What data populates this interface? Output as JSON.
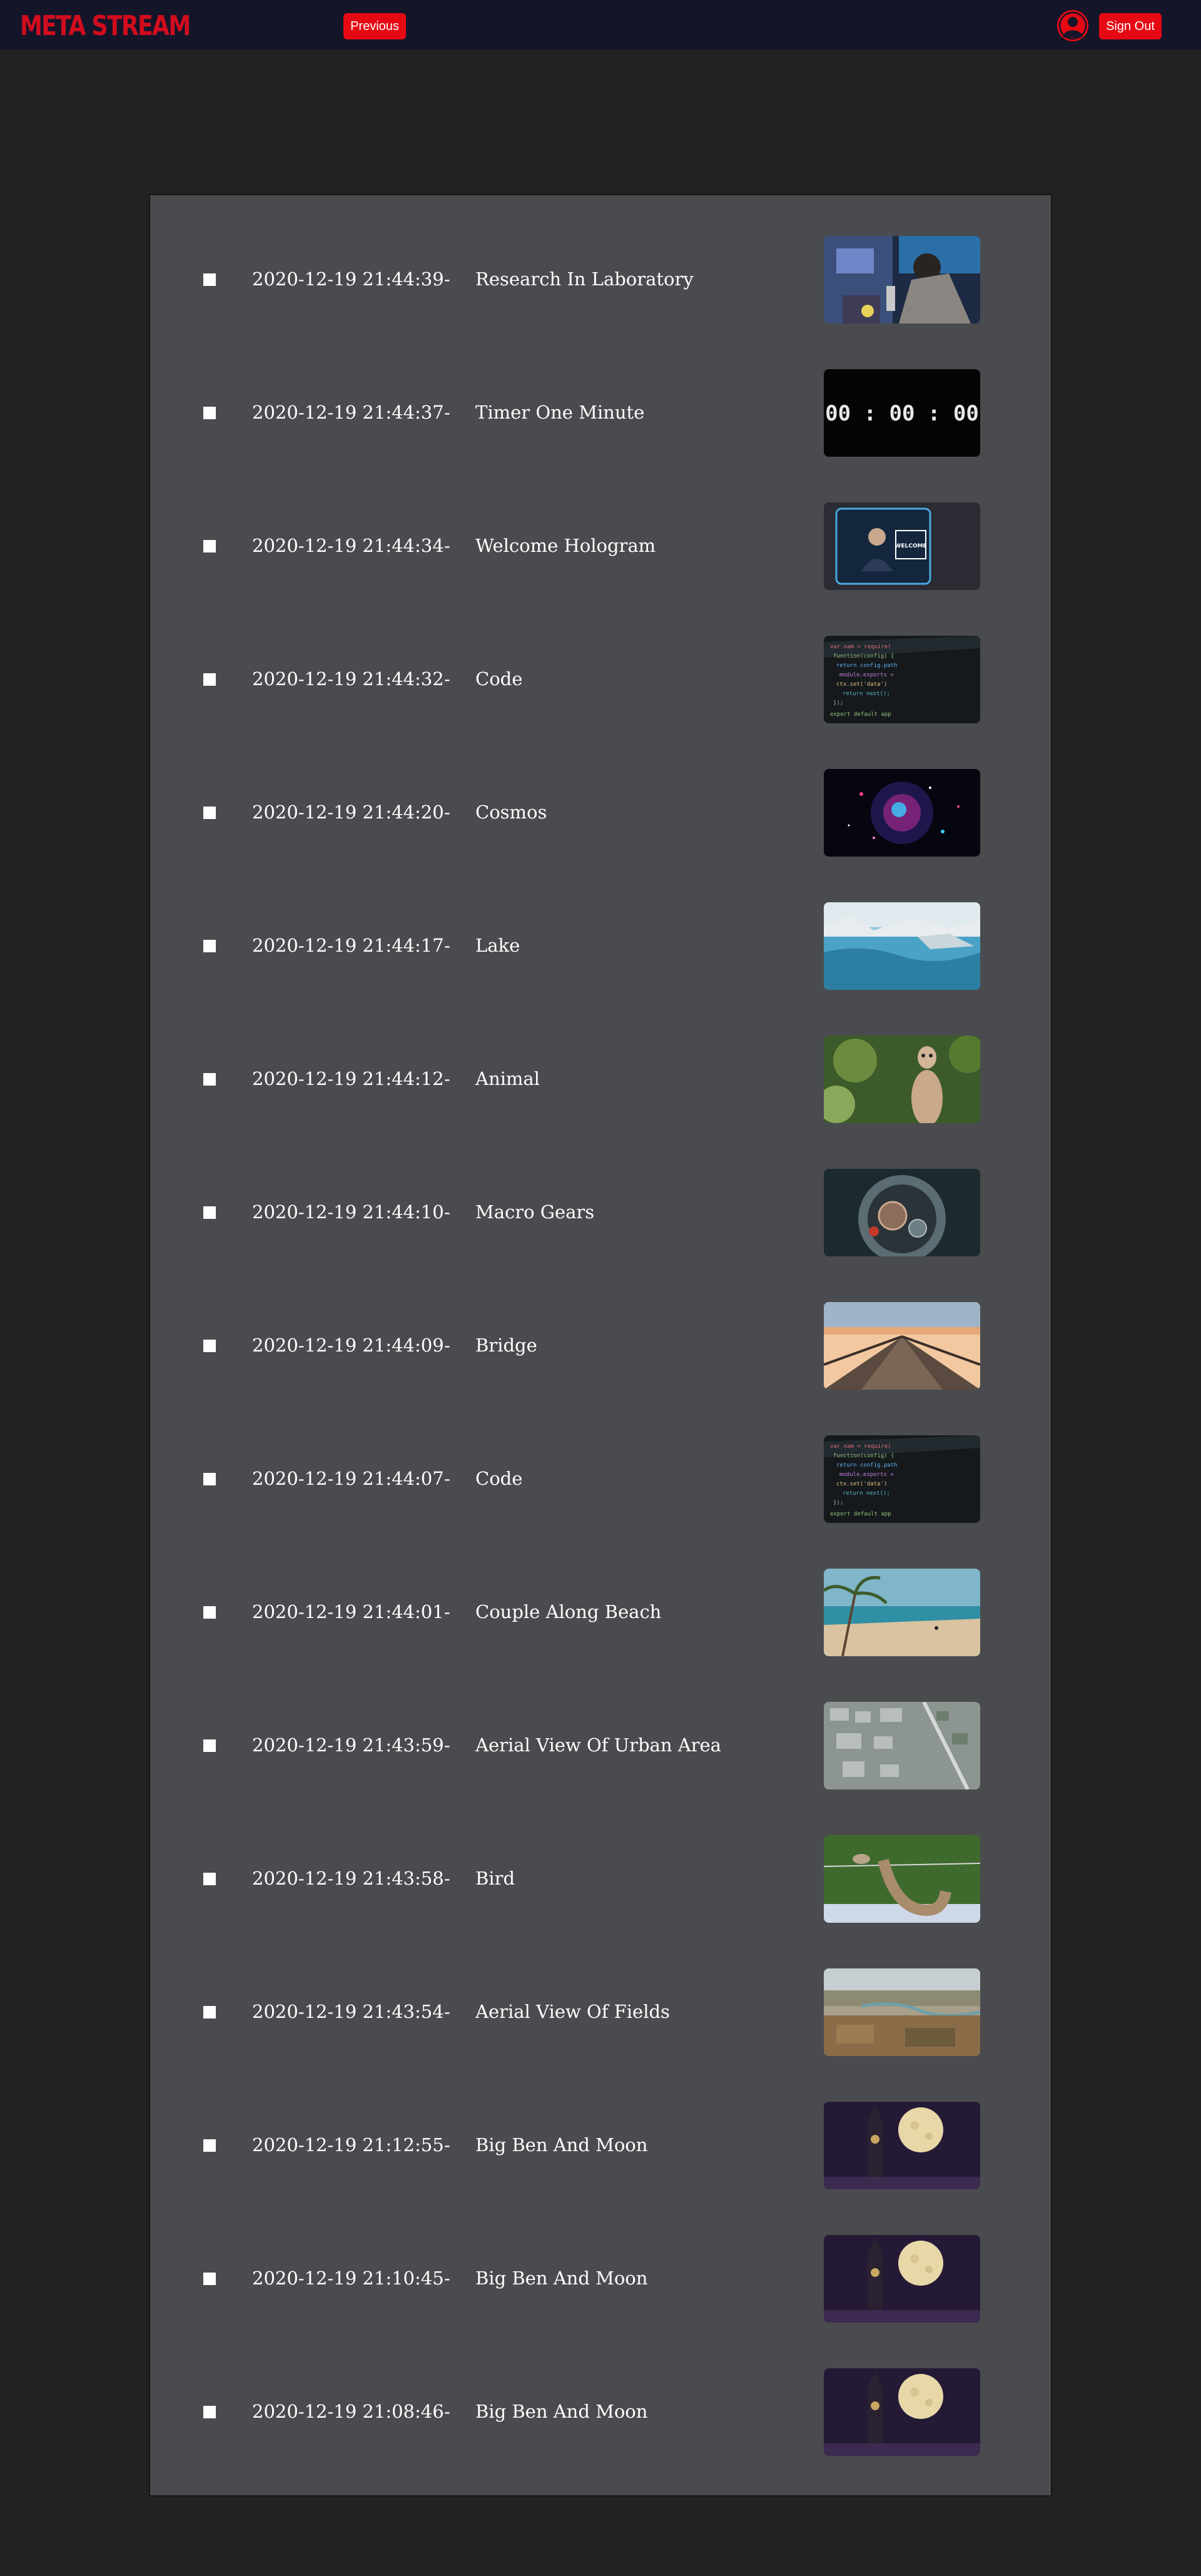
{
  "header": {
    "brand": "META STREAM",
    "previous_label": "Previous",
    "signout_label": "Sign Out",
    "accent_color": "#e50914",
    "brand_color": "#d10d1e",
    "navbar_color": "#15152a",
    "avatar_icon": "user-circle-icon"
  },
  "list": {
    "separator": "-",
    "items": [
      {
        "timestamp": "2020-12-19 21:44:39",
        "title": "Research In Laboratory",
        "thumbnail": "laboratory"
      },
      {
        "timestamp": "2020-12-19 21:44:37",
        "title": "Timer One Minute",
        "thumbnail": "timer",
        "thumb_text": "00 : 00 : 00"
      },
      {
        "timestamp": "2020-12-19 21:44:34",
        "title": "Welcome Hologram",
        "thumbnail": "hologram",
        "thumb_text": "WELCOME"
      },
      {
        "timestamp": "2020-12-19 21:44:32",
        "title": "Code",
        "thumbnail": "code"
      },
      {
        "timestamp": "2020-12-19 21:44:20",
        "title": "Cosmos",
        "thumbnail": "cosmos"
      },
      {
        "timestamp": "2020-12-19 21:44:17",
        "title": "Lake",
        "thumbnail": "lake"
      },
      {
        "timestamp": "2020-12-19 21:44:12",
        "title": "Animal",
        "thumbnail": "meerkat"
      },
      {
        "timestamp": "2020-12-19 21:44:10",
        "title": "Macro Gears",
        "thumbnail": "gears"
      },
      {
        "timestamp": "2020-12-19 21:44:09",
        "title": "Bridge",
        "thumbnail": "bridge"
      },
      {
        "timestamp": "2020-12-19 21:44:07",
        "title": "Code",
        "thumbnail": "code"
      },
      {
        "timestamp": "2020-12-19 21:44:01",
        "title": "Couple Along Beach",
        "thumbnail": "beach"
      },
      {
        "timestamp": "2020-12-19 21:43:59",
        "title": "Aerial View Of Urban Area",
        "thumbnail": "urban"
      },
      {
        "timestamp": "2020-12-19 21:43:58",
        "title": "Bird",
        "thumbnail": "bird"
      },
      {
        "timestamp": "2020-12-19 21:43:54",
        "title": "Aerial View Of Fields",
        "thumbnail": "fields"
      },
      {
        "timestamp": "2020-12-19 21:12:55",
        "title": "Big Ben And Moon",
        "thumbnail": "bigben"
      },
      {
        "timestamp": "2020-12-19 21:10:45",
        "title": "Big Ben And Moon",
        "thumbnail": "bigben"
      },
      {
        "timestamp": "2020-12-19 21:08:46",
        "title": "Big Ben And Moon",
        "thumbnail": "bigben"
      }
    ]
  }
}
